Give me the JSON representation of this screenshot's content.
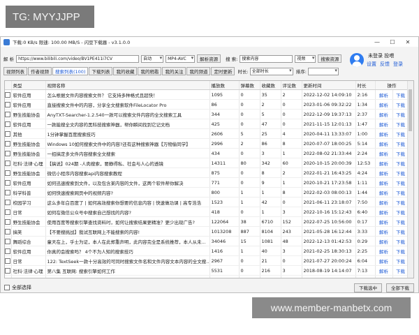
{
  "overlay": {
    "tg_label": "TG: MYYJJPP",
    "watermark": "www.member-manbetx.com"
  },
  "titlebar": {
    "text": "下载:0 KB/s  限速: 100.00 MB/S  - 闪豆下载器 - v3.1.0.0",
    "minimize": "—",
    "maximize": "☐",
    "close": "✕"
  },
  "toolbar": {
    "parse_label": "解 析",
    "url_value": "https://www.bilibili.com/video/BV1PE411i7CV",
    "mode_value": "自动",
    "format_value": "MP4-AVC",
    "parse_button": "解析资源",
    "search_label": "搜 索:",
    "search_value": "搜索内容",
    "search_type": "视频",
    "search_button": "搜索资源"
  },
  "tabs": [
    "视频列表",
    "作者视频",
    "搜索列表(100)",
    "下载列表",
    "我的收藏",
    "我的稍看",
    "我的关注",
    "我的频道",
    "定时更新"
  ],
  "filters": {
    "duration_label": "时长:",
    "duration_value": "全部时长",
    "sort_label": "排序:",
    "sort_value": ""
  },
  "user": {
    "status": "未登录 投喂",
    "links": [
      "设置",
      "反馈",
      "登录"
    ]
  },
  "table": {
    "columns": [
      "类型",
      "视频名称",
      "播放数",
      "弹幕数",
      "收藏数",
      "评论数",
      "更新时间",
      "时长",
      "操作"
    ],
    "action_parse": "解析",
    "action_download": "下载",
    "rows": [
      [
        "软件应用",
        "怎么根据文件内容搜索文件？ 它支持多种格式且超快！",
        "1095",
        "0",
        "35",
        "2",
        "2022-12-02 14:09:10",
        "2:16"
      ],
      [
        "软件应用",
        "直接搜索文件中的内容，分享全文搜索软件FileLocator Pro",
        "86",
        "0",
        "2",
        "0",
        "2023-01-06 09:32:22",
        "1:34"
      ],
      [
        "野生技能协会",
        "AnyTXT-Searcher-1.2.540一款可以搜索文件内容的全文搜索工具",
        "344",
        "0",
        "5",
        "0",
        "2022-12-09 19:37:13",
        "2:37"
      ],
      [
        "软件应用",
        "一款能搜全文内容的黑科技搜索神器，帮你瞬间找到它记文档",
        "425",
        "0",
        "47",
        "0",
        "2021-11-15 12:01:13",
        "1:47"
      ],
      [
        "其他",
        "1分钟掌握百度搜索技巧",
        "2606",
        "5",
        "25",
        "4",
        "2020-04-11 13:33:07",
        "1:00"
      ],
      [
        "野生技能协会",
        "Windows 10如何搜索文件中的内容?还有这种搜索神器【万物偷同学】",
        "2996",
        "2",
        "86",
        "8",
        "2020-07-07 18:00:25",
        "5:14"
      ],
      [
        "野生技能协会",
        "一招搞定多文件内容搜索全文搜索",
        "434",
        "0",
        "3",
        "1",
        "2022-08-02 21:33:44",
        "2:24"
      ],
      [
        "社科·法律·心理",
        "【搞说】024期 -人肉搜索，要静得私、社会与人心的透镜",
        "14311",
        "80",
        "342",
        "60",
        "2020-10-15 20:00:39",
        "12:53"
      ],
      [
        "野生技能协会",
        "微信小程序内容搜索api内容搜索教程",
        "875",
        "0",
        "8",
        "2",
        "2022-01-21 16:43:25",
        "4:24"
      ],
      [
        "软件应用",
        "如何迅速搜索到文件，以及包含某内容的文件，这两个软件帮你解决",
        "771",
        "0",
        "9",
        "1",
        "2020-10-21 17:23:58",
        "1:11"
      ],
      [
        "科学科普",
        "如何快速搜索网页中的视频内容?",
        "800",
        "1",
        "1",
        "8",
        "2022-02-03 08:00:13",
        "1:44"
      ],
      [
        "校园学习",
        "这么多年白百度了 | 如何高效搜索你想要的信息内容 | 快速做功课 | 高专浩浩",
        "1523",
        "1",
        "42",
        "0",
        "2021-06-11 23:18:07",
        "7:50"
      ],
      [
        "日常",
        "如何在微信公众号中搜索自己想找的内容?",
        "418",
        "0",
        "1",
        "3",
        "2022-10-16 15:12:43",
        "6:40"
      ],
      [
        "野生技能协会",
        "使用百度等搜索引擎查找资料时，如何让搜索结果更精准？更少出现广告?",
        "122064",
        "38",
        "6710",
        "152",
        "2022-07-25 10:56:00",
        "0:17"
      ],
      [
        "搞笑",
        "【不要搜挑战】我试互联网上不能搜索的内容!",
        "1013208",
        "887",
        "8104",
        "243",
        "2021-05-28 16:12:44",
        "3:33"
      ],
      [
        "舞蹈综合",
        "童天在上，乎士为证，本人在此郑重声明，此内容完全是系统推荐，本人从未...",
        "34046",
        "15",
        "1081",
        "48",
        "2022-12-13 01:42:53",
        "0:29"
      ],
      [
        "软件应用",
        "你真的会搜索吗？ 4个不为人知的搜索技巧",
        "1416",
        "1",
        "40",
        "3",
        "2021-02-25 18:30:13",
        "2:25"
      ],
      [
        "日常",
        "122: TextSeek一款十分高效的可同时搜索文件名和文件内容文本内容的全文搜...",
        "2967",
        "0",
        "21",
        "0",
        "2021-07-27 20:00:24",
        "6:04"
      ],
      [
        "社科·法律·心理",
        "第八集 互联网: 搜索引擎如何工作",
        "5531",
        "0",
        "216",
        "3",
        "2018-08-19 14:14:07",
        "7:13"
      ],
      [
        "软件应用",
        "如何批量搜索文件里的内容",
        "2204",
        "0",
        "38",
        "3",
        "2021-06-04 19:11:33",
        "0:59"
      ],
      [
        "软件应用",
        "如何在文件夹中搜索包含某内容的文件",
        "3318",
        "0",
        "26",
        "2",
        "2021-03-30 15:21:06",
        "1:27"
      ]
    ]
  },
  "footer": {
    "select_all": "全部选择",
    "download_selected": "下载选中",
    "download_all": "全部下载"
  }
}
